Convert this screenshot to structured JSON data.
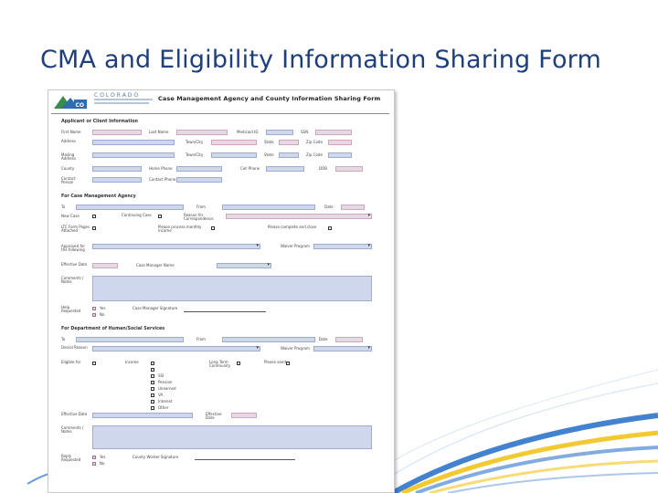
{
  "slide": {
    "title": "CMA and Eligibility Information Sharing Form"
  },
  "colors": {
    "title": "#1f3f7a",
    "field_pink": "#e8d8e4",
    "field_blue": "#cfd7ec",
    "swoosh_blue": "#2f74c9",
    "swoosh_yellow": "#f2c31c"
  },
  "form": {
    "logo": {
      "word": "COLORADO",
      "mark": "CO"
    },
    "title": "Case Management Agency and County Information Sharing Form",
    "sections": {
      "applicant": "Applicant or Client Information",
      "cma": "For Case Management Agency",
      "county": "For Department of Human/Social Services"
    },
    "labels": {
      "first_name": "First Name",
      "last_name": "Last Name",
      "medicaid_id": "Medicaid ID",
      "ssn": "SSN",
      "address": "Address",
      "city": "Town/City",
      "state": "State",
      "zip": "Zip Code",
      "mailing": "Mailing Address",
      "county": "County",
      "home_phone": "Home Phone",
      "cell_phone": "Cell Phone",
      "dob": "DOB",
      "contact": "Contact Person",
      "contact_phone": "Contact Phone",
      "to": "To",
      "from": "From",
      "date": "Date",
      "new_case": "New Case",
      "continuing_case": "Continuing Case",
      "reason": "Reason for Correspondence",
      "ltc_form": "LTC Form Pages Attached",
      "please_income": "Please process monthly income",
      "please_complete": "Please complete and close",
      "approved": "Approved for the following",
      "waiver_program": "Waiver Program",
      "effective": "Effective Date",
      "case_manager_note": "Case Manager Name",
      "comments": "Comments / Notes",
      "help": "Help Requested",
      "yes": "Yes",
      "no": "No",
      "cm_signature": "Case Manager Signature",
      "denial": "Denial Reason",
      "eligible": "Eligible for",
      "income": "Income",
      "ssi": "SSI",
      "pension": "Pension",
      "unearned": "Unearned",
      "va": "VA",
      "interest": "Interest",
      "other": "Other",
      "long_term": "Long Term Community",
      "request": "Please send",
      "reply": "Reply Requested",
      "worker_sig": "County Worker Signature"
    }
  }
}
